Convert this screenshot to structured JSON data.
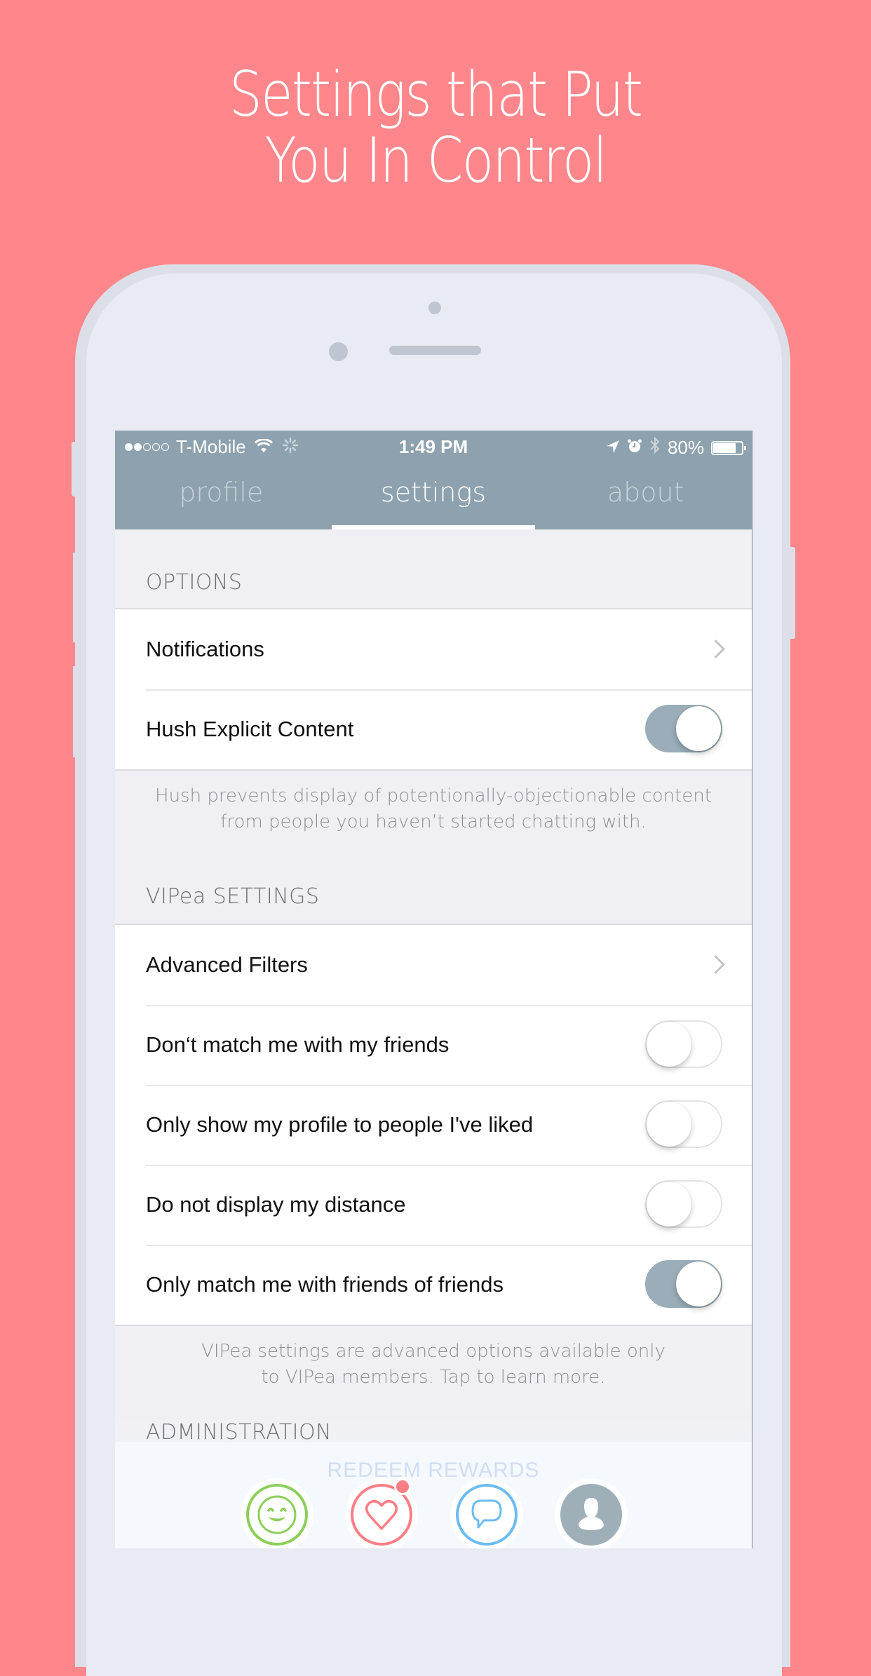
{
  "headline": {
    "line1": "Settings that Put",
    "line2": "You In Control"
  },
  "status_bar": {
    "signal_bars_filled": 2,
    "signal_bars_total": 5,
    "carrier": "T-Mobile",
    "time": "1:49 PM",
    "battery_percent": "80%",
    "battery_level": 0.8,
    "icons": [
      "wifi-icon",
      "activity-spinner-icon",
      "location-arrow-icon",
      "alarm-icon",
      "bluetooth-icon",
      "battery-icon"
    ]
  },
  "tabs": [
    {
      "label": "profile",
      "active": false
    },
    {
      "label": "settings",
      "active": true
    },
    {
      "label": "about",
      "active": false
    }
  ],
  "sections": {
    "options": {
      "header": "OPTIONS",
      "rows": [
        {
          "label": "Notifications",
          "control": "chevron"
        },
        {
          "label": "Hush Explicit Content",
          "control": "toggle",
          "on": true
        }
      ],
      "footer": "Hush prevents display of potentionally-objectionable content from people you haven’t started chatting with."
    },
    "vipea": {
      "header": "VIPea SETTINGS",
      "rows": [
        {
          "label": "Advanced Filters",
          "control": "chevron"
        },
        {
          "label": "Don‘t match me with my friends",
          "control": "toggle",
          "on": false
        },
        {
          "label": "Only show my profile to people I've liked",
          "control": "toggle",
          "on": false
        },
        {
          "label": "Do not display my distance",
          "control": "toggle",
          "on": false
        },
        {
          "label": "Only match me with friends of friends",
          "control": "toggle",
          "on": true
        }
      ],
      "footer": "VIPea settings are advanced options available only to VIPea members. Tap to learn more."
    },
    "administration": {
      "header": "ADMINISTRATION"
    }
  },
  "bottom_nav": {
    "ghost_text": "REDEEM REWARDS",
    "items": [
      {
        "name": "smiley-icon",
        "color": "#8ccf5a"
      },
      {
        "name": "heart-icon",
        "color": "#ff7e85",
        "badge": true
      },
      {
        "name": "chat-bubble-icon",
        "color": "#6cbcf0"
      },
      {
        "name": "profile-icon",
        "color": "#9eafb8"
      }
    ]
  },
  "colors": {
    "background": "#ff878c",
    "header_bar": "#8da2ae",
    "toggle_on": "#9aadb8"
  }
}
